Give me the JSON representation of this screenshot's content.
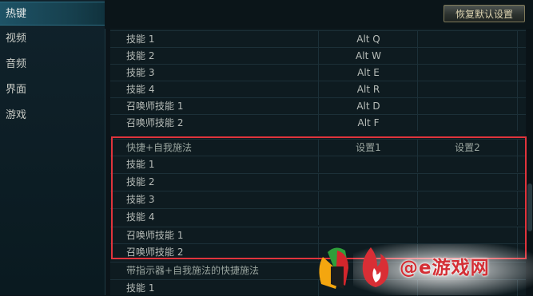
{
  "sidebar": {
    "items": [
      {
        "label": "热键",
        "active": true
      },
      {
        "label": "视频",
        "active": false
      },
      {
        "label": "音频",
        "active": false
      },
      {
        "label": "界面",
        "active": false
      },
      {
        "label": "游戏",
        "active": false
      }
    ]
  },
  "toolbar": {
    "reset_label": "恢复默认设置"
  },
  "rows": [
    {
      "name": "技能 1",
      "key1": "Alt  Q",
      "key2": ""
    },
    {
      "name": "技能 2",
      "key1": "Alt  W",
      "key2": ""
    },
    {
      "name": "技能 3",
      "key1": "Alt  E",
      "key2": ""
    },
    {
      "name": "技能 4",
      "key1": "Alt  R",
      "key2": ""
    },
    {
      "name": "召唤师技能 1",
      "key1": "Alt  D",
      "key2": ""
    },
    {
      "name": "召唤师技能 2",
      "key1": "Alt  F",
      "key2": ""
    }
  ],
  "section_quickcast": {
    "title": "快捷+自我施法",
    "col1": "设置1",
    "col2": "设置2",
    "rows": [
      {
        "name": "技能 1",
        "key1": "",
        "key2": ""
      },
      {
        "name": "技能 2",
        "key1": "",
        "key2": ""
      },
      {
        "name": "技能 3",
        "key1": "",
        "key2": ""
      },
      {
        "name": "技能 4",
        "key1": "",
        "key2": ""
      },
      {
        "name": "召唤师技能 1",
        "key1": "",
        "key2": ""
      },
      {
        "name": "召唤师技能 2",
        "key1": "",
        "key2": ""
      }
    ]
  },
  "section_indicator": {
    "title": "带指示器+自我施法的快捷施法",
    "rows": [
      {
        "name": "技能 1",
        "key1": "",
        "key2": ""
      }
    ]
  },
  "watermark": {
    "text": "@e游戏网"
  },
  "colors": {
    "highlight": "#e0343c",
    "active_tab": "#1e5366"
  }
}
